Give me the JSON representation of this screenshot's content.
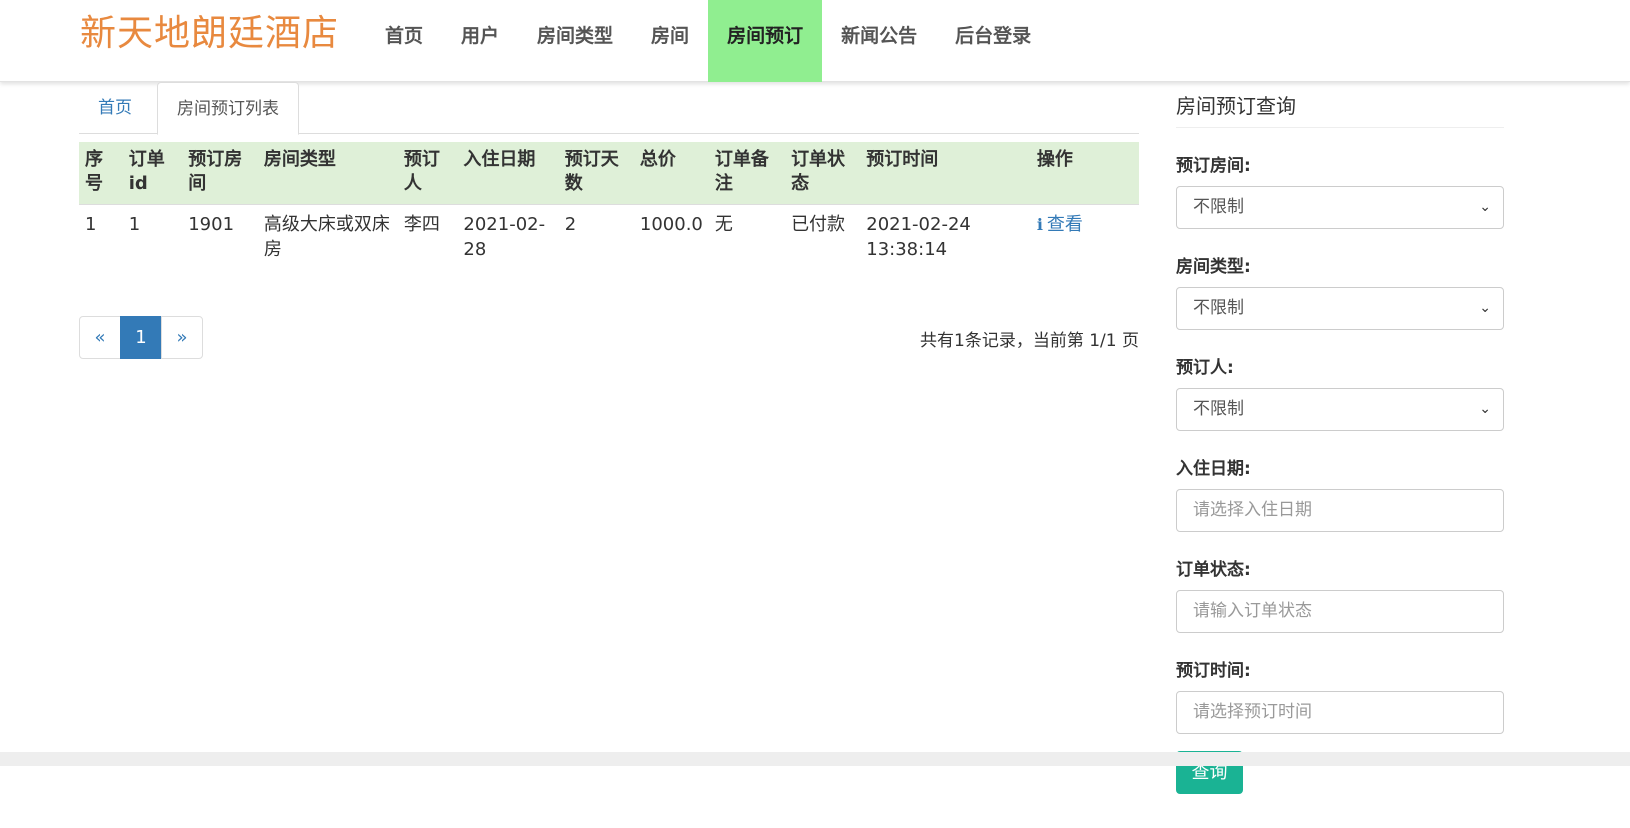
{
  "brand": "新天地朗廷酒店",
  "nav": [
    "首页",
    "用户",
    "房间类型",
    "房间",
    "房间预订",
    "新闻公告",
    "后台登录"
  ],
  "nav_active_index": 4,
  "tabs": {
    "home": "首页",
    "current": "房间预订列表"
  },
  "table": {
    "headers": [
      "序号",
      "订单id",
      "预订房间",
      "房间类型",
      "预订人",
      "入住日期",
      "预订天数",
      "总价",
      "订单备注",
      "订单状态",
      "预订时间",
      "操作"
    ],
    "rows": [
      {
        "seq": "1",
        "order_id": "1",
        "room": "1901",
        "room_type": "高级大床或双床房",
        "booker": "李四",
        "checkin": "2021-02-28",
        "days": "2",
        "total": "1000.0",
        "remark": "无",
        "status": "已付款",
        "booked_at": "2021-02-24 13:38:14",
        "action": "查看"
      }
    ]
  },
  "pagination": {
    "prev": "«",
    "current": "1",
    "next": "»",
    "summary": "共有1条记录，当前第 1/1 页"
  },
  "sidebar": {
    "title": "房间预订查询",
    "fields": {
      "room": {
        "label": "预订房间:",
        "value": "不限制"
      },
      "room_type": {
        "label": "房间类型:",
        "value": "不限制"
      },
      "booker": {
        "label": "预订人:",
        "value": "不限制"
      },
      "checkin": {
        "label": "入住日期:",
        "placeholder": "请选择入住日期"
      },
      "status": {
        "label": "订单状态:",
        "placeholder": "请输入订单状态"
      },
      "booked_at": {
        "label": "预订时间:",
        "placeholder": "请选择预订时间"
      }
    },
    "submit": "查询"
  },
  "icons": {
    "view": "info-icon",
    "select": "chevron-down-icon"
  },
  "colors": {
    "brand": "#e8893f",
    "nav_active": "#90ee90",
    "table_header": "#dff0d8",
    "link": "#337ab7",
    "button": "#1ab394"
  }
}
